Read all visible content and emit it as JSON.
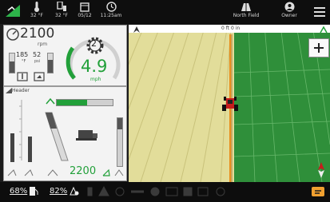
{
  "status_bar": {
    "temp_1": "32 °F",
    "temp_2": "32 °F",
    "date": "05/12",
    "time": "11:25am",
    "field_name": "North Field",
    "user": "Owner"
  },
  "engine": {
    "rpm_value": "2100",
    "rpm_unit": "rpm",
    "gear": "2",
    "speed": "4.9",
    "speed_unit": "mph",
    "gauge_1_value": "185",
    "gauge_1_unit": "°F",
    "gauge_2_value": "52",
    "gauge_2_unit": "psi"
  },
  "header_panel": {
    "title": "Header",
    "height_value": "2200"
  },
  "guidance": {
    "offset": "0 ft 0 in"
  },
  "bottom_bar": {
    "fuel_percent": "68%",
    "def_percent": "82%"
  },
  "colors": {
    "accent_green": "#22a03a",
    "alert_orange": "#f0a030",
    "guidance_orange": "#e98e1d"
  }
}
